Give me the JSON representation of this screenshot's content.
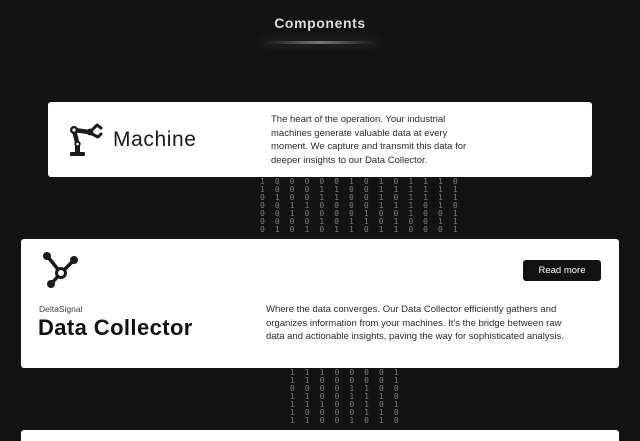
{
  "page": {
    "heading": "Components"
  },
  "binary_stream_top": [
    "1 0 0 0 0 0 1 0 1 0 1 1 1 0",
    "1 0 0 0 1 1 0 0 1 1 1 1 1 1",
    "0 1 0 0 1 1 0 0 1 0 1 1 1 1",
    "0 0 1 1 0 0 0 0 1 1 1 0 1 0",
    "0 0 1 0 0 0 0 1 0 0 1 0 0 1",
    "0 0 0 0 1 0 1 1 0 1 0 0 1 1",
    "0 1 0 1 0 1 1 0 1 1 0 0 0 1"
  ],
  "binary_stream_bottom": [
    "1 1 1 0 0 0 0 1",
    "1 1 0 0 0 0 0 1",
    "0 0 0 0 1 1 0 0",
    "1 1 0 0 1 1 1 0",
    "1 1 1 0 0 1 0 1",
    "1 0 0 0 0 1 1 0",
    "1 1 0 0 1 0 1 0"
  ],
  "machine": {
    "icon": "robot-arm-icon",
    "title": "Machine",
    "description": "The heart of the operation. Your industrial machines generate valuable data at every moment. We capture and transmit this data for deeper insights to our Data Collector."
  },
  "collector": {
    "icon": "hub-nodes-icon",
    "brand": "DeltaSignal",
    "title": "Data Collector",
    "button_label": "Read more",
    "description": "Where the data converges. Our Data Collector efficiently gathers and organizes information from your machines. It's the bridge between raw data and actionable insights, paving the way for sophisticated analysis."
  },
  "colors": {
    "background": "#131314",
    "card": "#ffffff",
    "button": "#111111"
  }
}
